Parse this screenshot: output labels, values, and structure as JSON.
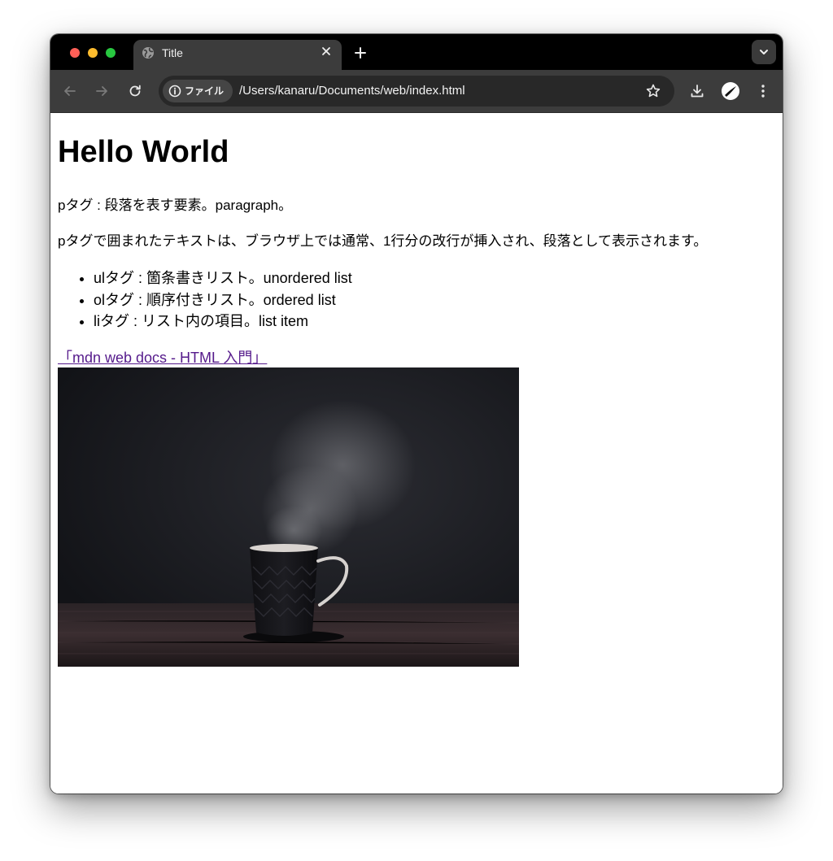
{
  "browser": {
    "tab": {
      "title": "Title"
    },
    "address_bar": {
      "site_chip_label": "ファイル",
      "url": "/Users/kanaru/Documents/web/index.html"
    }
  },
  "page": {
    "heading": "Hello World",
    "paragraphs": [
      "pタグ : 段落を表す要素。paragraph。",
      "pタグで囲まれたテキストは、ブラウザ上では通常、1行分の改行が挿入され、段落として表示されます。"
    ],
    "list_items": [
      "ulタグ : 箇条書きリスト。unordered list",
      "olタグ : 順序付きリスト。ordered list",
      "liタグ : リスト内の項目。list item"
    ],
    "link_text": "「mdn web docs - HTML 入門」",
    "image": {
      "subject": "steaming coffee cup on wooden table"
    }
  },
  "colors": {
    "tab_bar": "#000000",
    "toolbar": "#3c3c3c",
    "omnibox": "#282828",
    "visited_link": "#551a8b"
  }
}
